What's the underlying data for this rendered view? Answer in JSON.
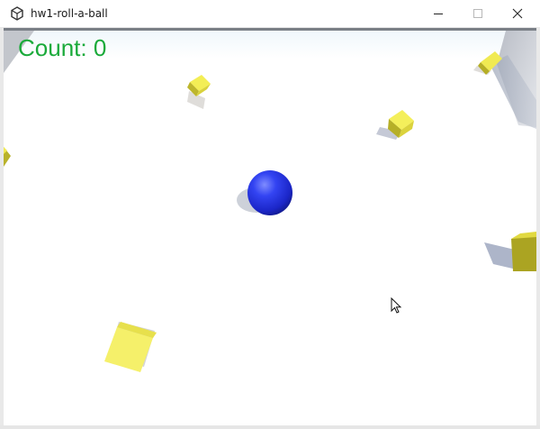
{
  "window": {
    "title": "hw1-roll-a-ball"
  },
  "hud": {
    "count_text": "Count: 0"
  },
  "colors": {
    "count_text": "#1aaa3a",
    "ball": "#2233ee",
    "pickup": "#f2ec5a",
    "floor": "#ffffff",
    "wall": "#c7c9cf"
  }
}
